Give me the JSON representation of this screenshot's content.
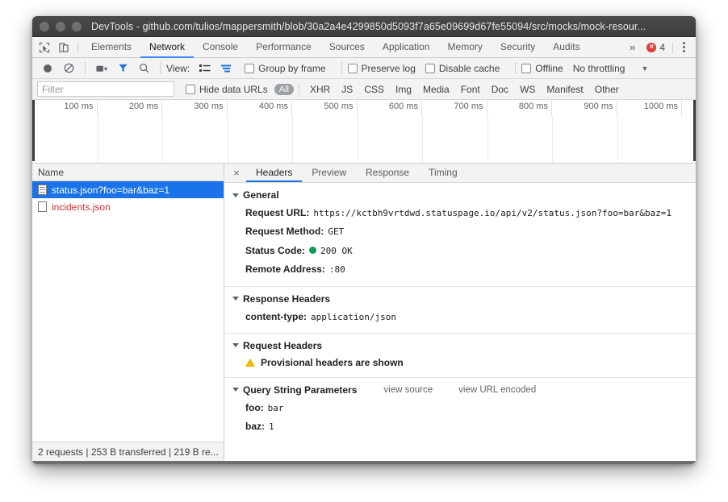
{
  "window": {
    "title": "DevTools - github.com/tulios/mappersmith/blob/30a2a4e4299850d5093f7a65e09699d67fe55094/src/mocks/mock-resour...",
    "traffic_lights": [
      "close",
      "minimize",
      "maximize"
    ]
  },
  "panel_tabs": {
    "items": [
      {
        "label": "Elements",
        "active": false
      },
      {
        "label": "Network",
        "active": true
      },
      {
        "label": "Console",
        "active": false
      },
      {
        "label": "Performance",
        "active": false
      },
      {
        "label": "Sources",
        "active": false
      },
      {
        "label": "Application",
        "active": false
      },
      {
        "label": "Memory",
        "active": false
      },
      {
        "label": "Security",
        "active": false
      },
      {
        "label": "Audits",
        "active": false
      }
    ],
    "overflow_label": "»",
    "error_count": "4"
  },
  "network_toolbar": {
    "view_label": "View:",
    "group_by_frame": "Group by frame",
    "preserve_log": "Preserve log",
    "disable_cache": "Disable cache",
    "offline": "Offline",
    "throttling": "No throttling",
    "throttling_caret": "▼"
  },
  "filter_row": {
    "filter_placeholder": "Filter",
    "filter_value": "",
    "hide_data_urls": "Hide data URLs",
    "types": [
      {
        "label": "All",
        "active": true
      },
      {
        "label": "XHR",
        "active": false
      },
      {
        "label": "JS",
        "active": false
      },
      {
        "label": "CSS",
        "active": false
      },
      {
        "label": "Img",
        "active": false
      },
      {
        "label": "Media",
        "active": false
      },
      {
        "label": "Font",
        "active": false
      },
      {
        "label": "Doc",
        "active": false
      },
      {
        "label": "WS",
        "active": false
      },
      {
        "label": "Manifest",
        "active": false
      },
      {
        "label": "Other",
        "active": false
      }
    ]
  },
  "timeline": {
    "ticks": [
      "100 ms",
      "200 ms",
      "300 ms",
      "400 ms",
      "500 ms",
      "600 ms",
      "700 ms",
      "800 ms",
      "900 ms",
      "1000 ms"
    ]
  },
  "request_list": {
    "column_header": "Name",
    "rows": [
      {
        "name": "status.json?foo=bar&baz=1",
        "selected": true,
        "failed": false
      },
      {
        "name": "incidents.json",
        "selected": false,
        "failed": true
      }
    ],
    "status_bar": "2 requests | 253 B transferred | 219 B re..."
  },
  "detail_tabs": {
    "close_label": "×",
    "items": [
      {
        "label": "Headers",
        "active": true
      },
      {
        "label": "Preview",
        "active": false
      },
      {
        "label": "Response",
        "active": false
      },
      {
        "label": "Timing",
        "active": false
      }
    ]
  },
  "details": {
    "general": {
      "title": "General",
      "request_url_key": "Request URL:",
      "request_url_value": "https://kctbh9vrtdwd.statuspage.io/api/v2/status.json?foo=bar&baz=1",
      "request_method_key": "Request Method:",
      "request_method_value": "GET",
      "status_code_key": "Status Code:",
      "status_code_value": "200 OK",
      "status_color": "#0f9d58",
      "remote_address_key": "Remote Address:",
      "remote_address_value": ":80"
    },
    "response_headers": {
      "title": "Response Headers",
      "content_type_key": "content-type:",
      "content_type_value": "application/json"
    },
    "request_headers": {
      "title": "Request Headers",
      "warning": "Provisional headers are shown"
    },
    "query_string": {
      "title": "Query String Parameters",
      "view_source": "view source",
      "view_url_encoded": "view URL encoded",
      "params": [
        {
          "key": "foo:",
          "value": "bar"
        },
        {
          "key": "baz:",
          "value": "1"
        }
      ]
    }
  }
}
